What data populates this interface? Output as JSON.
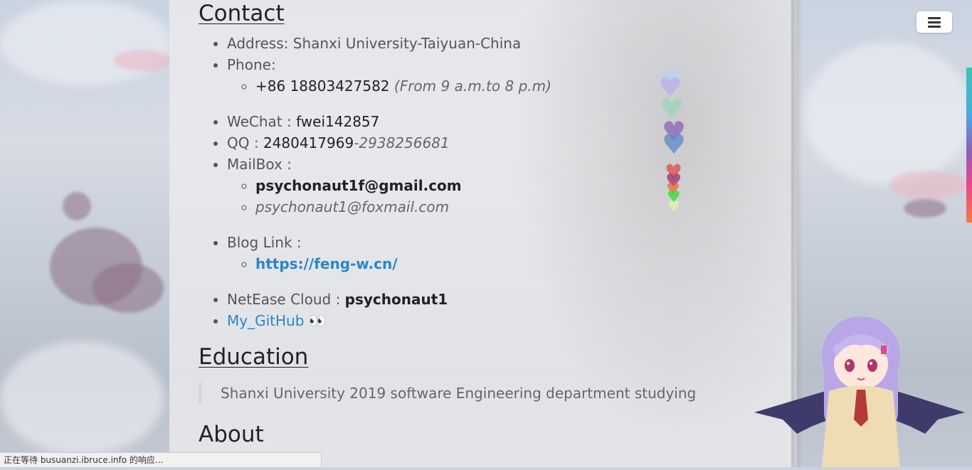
{
  "contact": {
    "heading": "Contact",
    "address_label": "Address: Shanxi University-Taiyuan-China",
    "phone_label": "Phone:",
    "phone_number": "+86 18803427582",
    "phone_hours": "(From 9 a.m.to 8 p.m)",
    "wechat_label": "WeChat : ",
    "wechat_value": "fwei142857",
    "qq_label": "QQ : ",
    "qq_value": "2480417969",
    "qq_alt": "-2938256681",
    "mailbox_label": "MailBox :",
    "mail_primary": "psychonaut1f@gmail.com",
    "mail_secondary": "psychonaut1@foxmail.com",
    "blog_label": "Blog Link :",
    "blog_url": "https://feng-w.cn/",
    "netease_label": "NetEase Cloud : ",
    "netease_value": "psychonaut1",
    "github_link": "My_GitHub",
    "github_emoji": "👀"
  },
  "education": {
    "heading": "Education",
    "text": "Shanxi University 2019 software Engineering department studying"
  },
  "about": {
    "heading": "About"
  },
  "status_bar": {
    "text": "正在等待 busuanzi.ibruce.info 的响应..."
  },
  "colors": {
    "link": "#2a86c8",
    "accent_strip_top": "#3cc3b5",
    "accent_strip_bottom": "#f47a45"
  },
  "icons": {
    "menu": "hamburger-icon",
    "hearts": "heart-icon"
  }
}
